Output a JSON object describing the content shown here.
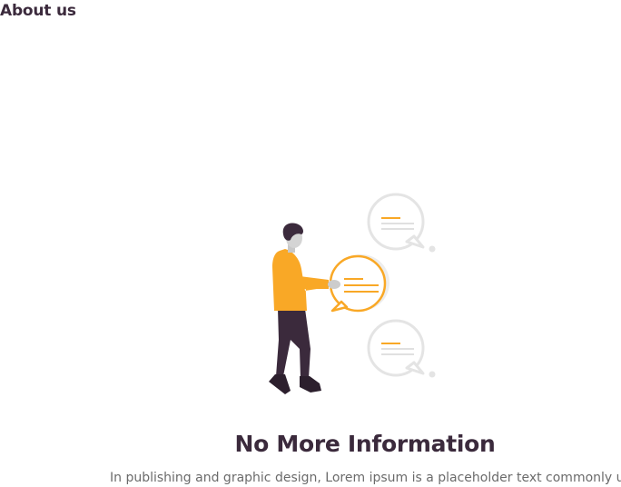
{
  "header": {
    "title": "About us"
  },
  "empty_state": {
    "illustration_icon": "person-chat-bubbles-illustration",
    "title": "No More Information",
    "description": "In publishing and graphic design, Lorem ipsum is a placeholder text commonly u"
  },
  "colors": {
    "title": "#3b2a3c",
    "accent": "#f9a826",
    "description": "#6b6b6b",
    "bubble_gray": "#e6e6e6"
  }
}
